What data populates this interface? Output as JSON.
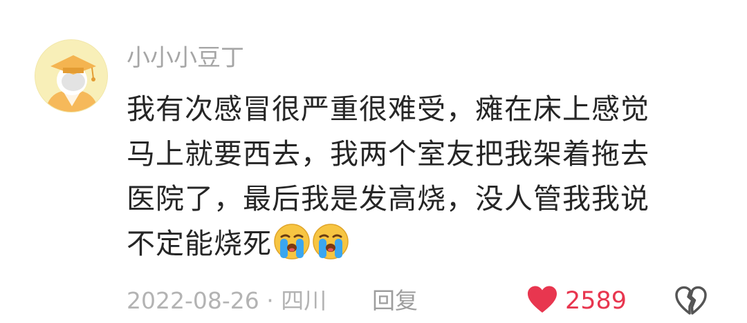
{
  "comment": {
    "username": "小小小豆丁",
    "text_lines": [
      "我有次感冒很严重很难受，瘫在床上感觉",
      "马上就要西去，我两个室友把我架着拖去",
      "医院了，最后我是发高烧，没人管我我说",
      "不定能烧死"
    ],
    "emojis": [
      "crying-face-emoji",
      "crying-face-emoji"
    ],
    "date": "2022-08-26",
    "separator": "·",
    "location": "四川",
    "reply_label": "回复",
    "like_count": "2589",
    "like_color": "#e8364f",
    "icons": {
      "like": "heart-icon",
      "dislike": "broken-heart-icon"
    }
  }
}
